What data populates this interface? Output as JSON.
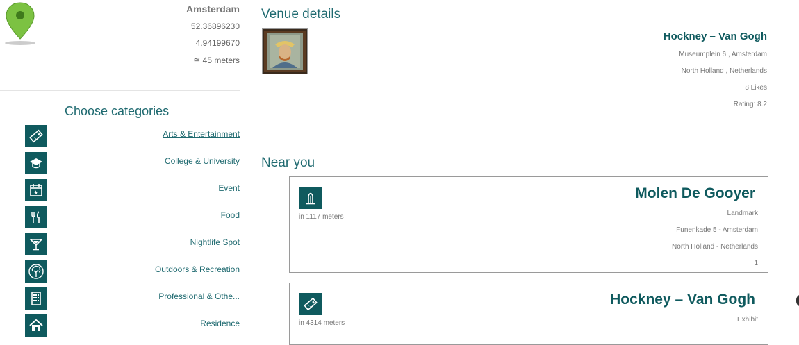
{
  "location": {
    "city": "Amsterdam",
    "latitude": "52.36896230",
    "longitude": "4.94199670",
    "accuracy": "≅ 45 meters"
  },
  "categories": {
    "title": "Choose categories",
    "items": [
      {
        "label": "Arts & Entertainment",
        "icon": "ticket-icon",
        "active": true
      },
      {
        "label": "College & University",
        "icon": "graduation-cap-icon"
      },
      {
        "label": "Event",
        "icon": "calendar-star-icon"
      },
      {
        "label": "Food",
        "icon": "fork-knife-icon"
      },
      {
        "label": "Nightlife Spot",
        "icon": "cocktail-icon"
      },
      {
        "label": "Outdoors & Recreation",
        "icon": "tree-icon"
      },
      {
        "label": "Professional & Othe...",
        "icon": "office-building-icon"
      },
      {
        "label": "Residence",
        "icon": "home-icon"
      }
    ]
  },
  "venue": {
    "section_title": "Venue details",
    "name": "Hockney – Van Gogh",
    "address": "Museumplein 6 , Amsterdam",
    "region": "North Holland , Netherlands",
    "likes": "8 Likes",
    "rating": "Rating: 8.2"
  },
  "near": {
    "section_title": "Near you",
    "cards": [
      {
        "name": "Molen De Gooyer",
        "distance": "in 1117 meters",
        "category": "Landmark",
        "address": "Funenkade 5 - Amsterdam",
        "region": "North Holland - Netherlands",
        "extra": "1",
        "icon": "monument-icon"
      },
      {
        "name": "Hockney – Van Gogh",
        "distance": "in 4314 meters",
        "category": "Exhibit",
        "icon": "ticket-icon"
      }
    ]
  },
  "colors": {
    "accent": "#0f5a5e",
    "pin": "#7cc242"
  }
}
